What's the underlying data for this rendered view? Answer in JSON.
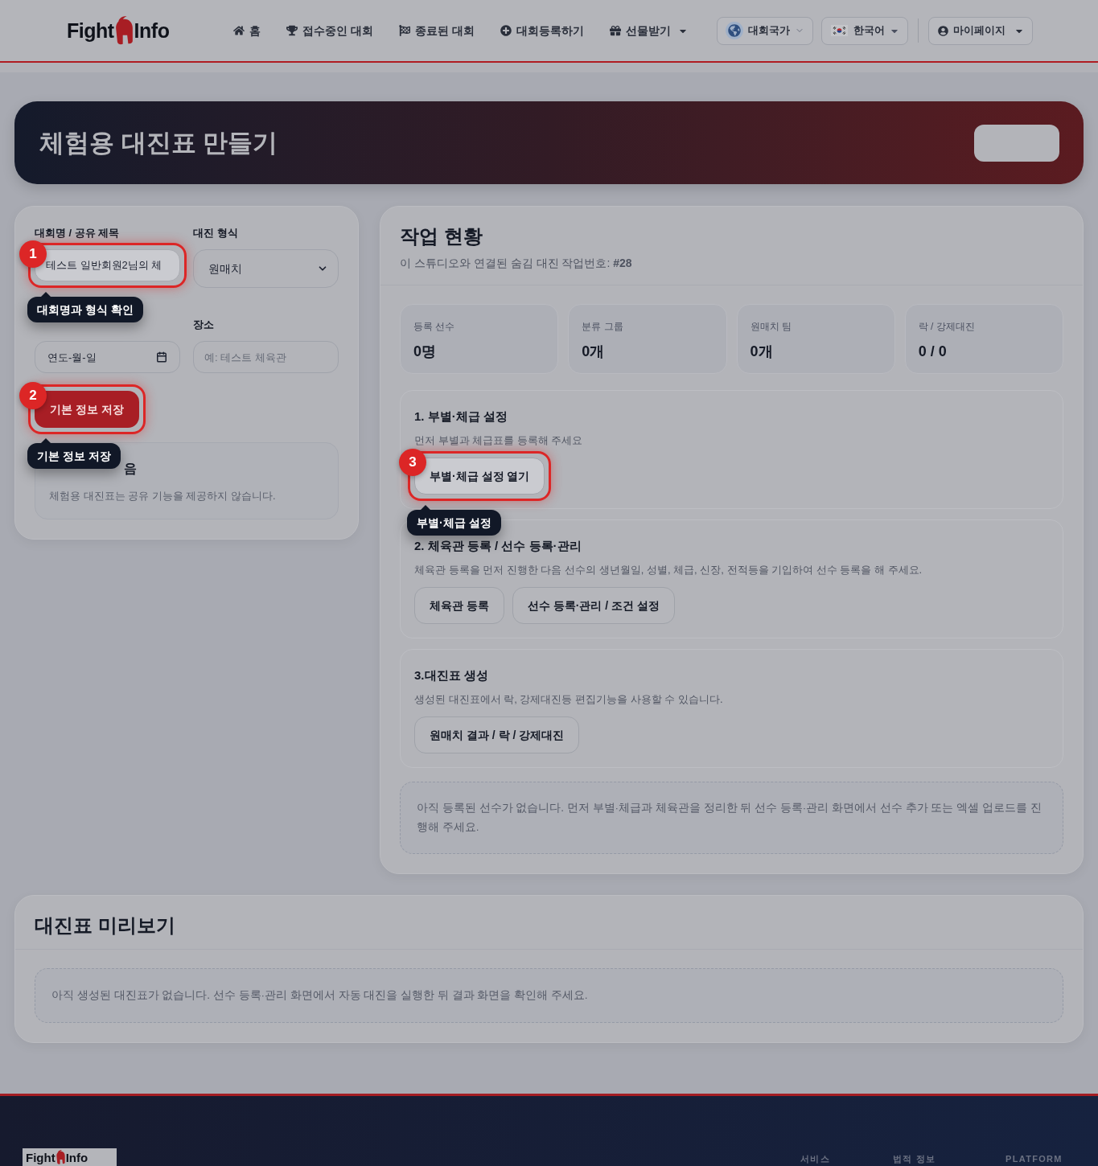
{
  "header": {
    "logo": {
      "word_1": "Fight",
      "word_2": "Info"
    },
    "nav": [
      {
        "label": "홈",
        "has_menu": false
      },
      {
        "label": "접수중인 대회",
        "has_menu": false
      },
      {
        "label": "종료된 대회",
        "has_menu": false
      },
      {
        "label": "대회등록하기",
        "has_menu": false
      },
      {
        "label": "선물받기",
        "has_menu": true
      }
    ],
    "country_button": {
      "label": "대회국가"
    },
    "language_button": {
      "label": "한국어"
    },
    "account_button": {
      "label": "마이페이지"
    }
  },
  "banner": {
    "title": "체험용 대진표 만들기"
  },
  "basic_info": {
    "fields": [
      {
        "kind": "text",
        "label": "대회명 / 공유 제목",
        "value": "테스트 일반회원2님의 체",
        "tour": {
          "step": "1",
          "tooltip": "대회명과 형식 확인"
        }
      },
      {
        "kind": "select",
        "label": "대진 형식",
        "value": "원매치"
      },
      {
        "kind": "date",
        "placeholder": "연도-월-일"
      },
      {
        "kind": "text",
        "label": "장소",
        "placeholder": "예: 테스트 체육관"
      }
    ],
    "save_button": {
      "label": "기본 정보 저장",
      "tour": {
        "step": "2",
        "tooltip": "기본 정보 저장"
      }
    },
    "share_notice": {
      "title": "음",
      "text": "체험용 대진표는 공유 기능을 제공하지 않습니다."
    }
  },
  "status_panel": {
    "title": "작업 현황",
    "subtitle": "이 스튜디오와 연결된 숨김 대진 작업번호: **#28**",
    "stats": [
      {
        "label": "등록 선수",
        "value": "0명"
      },
      {
        "label": "분류 그룹",
        "value": "0개"
      },
      {
        "label": "원매치 팀",
        "value": "0개"
      },
      {
        "label": "락 / 강제대진",
        "value": "0 / 0"
      }
    ],
    "steps": [
      {
        "title": "1. 부별·체급 설정",
        "description": "먼저 부별과 체급표를 등록해 주세요",
        "buttons": [
          {
            "label": "부별·체급 설정 열기",
            "tour": {
              "step": "3",
              "tooltip": "부별·체급 설정"
            }
          }
        ]
      },
      {
        "title": "2. 체육관 등록 / 선수 등록·관리",
        "description": "체육관 등록을 먼저 진행한 다음 선수의 생년월일, 성별, 체급, 신장, 전적등을 기입하여 선수 등록을 해 주세요.",
        "buttons": [
          {
            "label": "체육관 등록"
          },
          {
            "label": "선수 등록·관리 / 조건 설정"
          }
        ]
      },
      {
        "title": "3.대진표 생성",
        "description": "생성된 대진표에서 락, 강제대진등 편집기능을 사용할 수 있습니다.",
        "buttons": [
          {
            "label": "원매치 결과 / 락 / 강제대진"
          }
        ]
      }
    ],
    "notice": "아직 등록된 선수가 없습니다. 먼저 부별·체급과 체육관을 정리한 뒤 선수 등록·관리 화면에서 선수 추가 또는 엑셀 업로드를 진행해 주세요."
  },
  "preview": {
    "title": "대진표 미리보기",
    "notice": "아직 생성된 대진표가 없습니다. 선수 등록·관리 화면에서 자동 대진을 실행한 뒤 결과 화면을 확인해 주세요."
  },
  "footer": {
    "logo": {
      "word_1": "Fight",
      "word_2": "Info"
    },
    "headings": [
      "서비스",
      "법적 정보",
      "PLATFORM"
    ]
  }
}
